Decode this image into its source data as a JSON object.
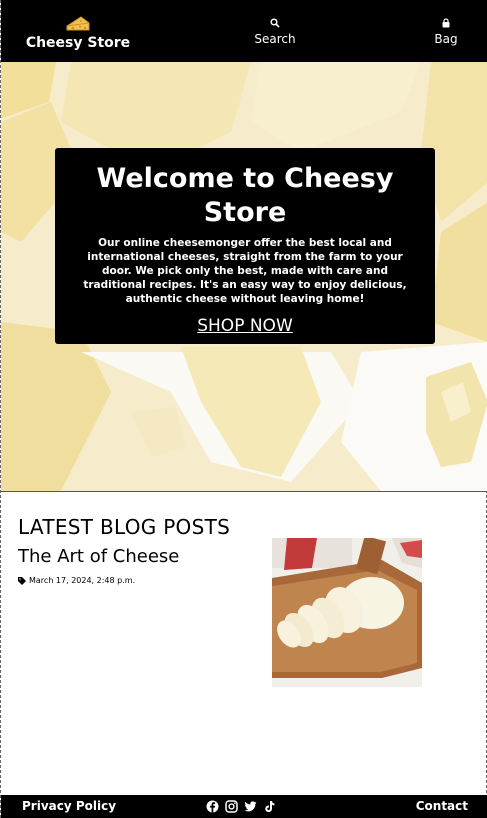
{
  "header": {
    "brand_name": "Cheesy Store",
    "brand_icon": "cheese-icon",
    "nav": {
      "search_label": "Search",
      "search_icon": "search-icon",
      "bag_label": "Bag",
      "bag_icon": "bag-icon"
    }
  },
  "hero": {
    "title": "Welcome to Cheesy Store",
    "text": "Our online cheesemonger offer the best local and international cheeses, straight from the farm to your door. We pick only the best, made with care and traditional recipes. It's an easy way to enjoy delicious, authentic cheese without leaving home!",
    "cta_label": "SHOP NOW"
  },
  "blog": {
    "section_title": "LATEST BLOG POSTS",
    "posts": [
      {
        "title": "The Art of Cheese",
        "date": "March 17, 2024, 2:48 p.m.",
        "meta_icon": "tag-icon"
      }
    ]
  },
  "footer": {
    "privacy_label": "Privacy Policy",
    "contact_label": "Contact",
    "socials": [
      "facebook-icon",
      "instagram-icon",
      "twitter-icon",
      "tiktok-icon"
    ]
  },
  "colors": {
    "header_bg": "#000000",
    "footer_bg": "#000000",
    "hero_box_bg": "#000000",
    "text_light": "#ffffff"
  }
}
